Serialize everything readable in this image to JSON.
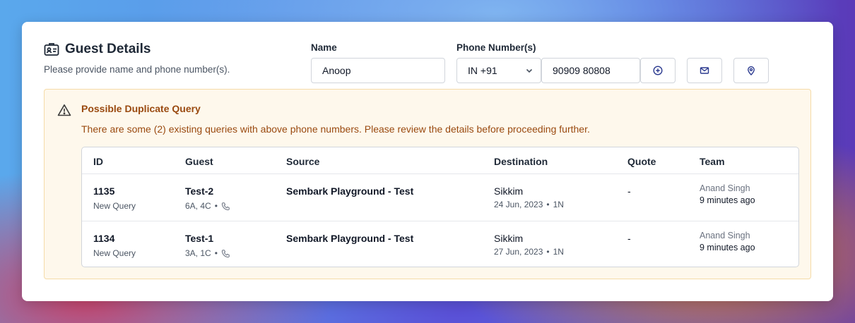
{
  "header": {
    "title": "Guest Details",
    "subtitle": "Please provide name and phone number(s)."
  },
  "form": {
    "name_label": "Name",
    "name_value": "Anoop",
    "phone_label": "Phone Number(s)",
    "country_code": "IN +91",
    "phone_value": "90909 80808"
  },
  "actions": {
    "icons": [
      "plus-circle-icon",
      "mail-icon",
      "location-pin-icon"
    ]
  },
  "alert": {
    "title": "Possible Duplicate Query",
    "message": "There are some (2) existing queries with above phone numbers. Please review the details before proceeding further."
  },
  "table": {
    "columns": [
      "ID",
      "Guest",
      "Source",
      "Destination",
      "Quote",
      "Team"
    ],
    "rows": [
      {
        "id": "1135",
        "status": "New Query",
        "guest": "Test-2",
        "pax": "6A, 4C",
        "source": "Sembark Playground - Test",
        "destination": "Sikkim",
        "date": "24 Jun, 2023",
        "nights": "1N",
        "quote": "-",
        "team_member": "Anand Singh",
        "time_ago": "9 minutes ago"
      },
      {
        "id": "1134",
        "status": "New Query",
        "guest": "Test-1",
        "pax": "3A, 1C",
        "source": "Sembark Playground - Test",
        "destination": "Sikkim",
        "date": "27 Jun, 2023",
        "nights": "1N",
        "quote": "-",
        "team_member": "Anand Singh",
        "time_ago": "9 minutes ago"
      }
    ]
  },
  "colors": {
    "alert_bg": "#fef8ec",
    "alert_border": "#f5dba7",
    "alert_text": "#9a4a10",
    "icon_blue": "#2b3a8f"
  }
}
